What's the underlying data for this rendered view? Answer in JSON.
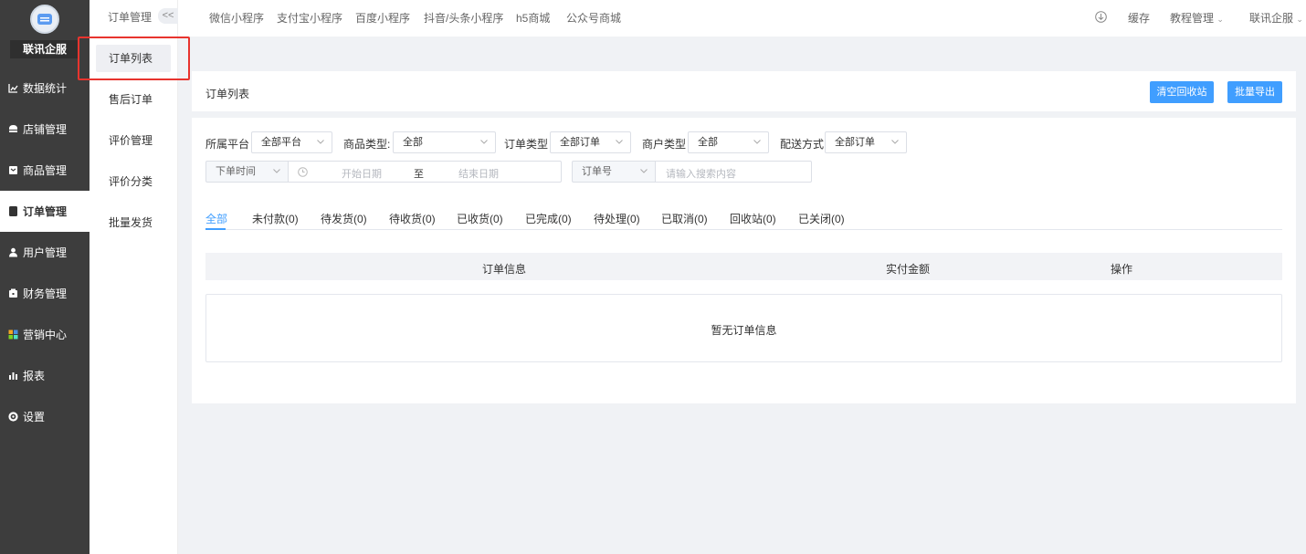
{
  "brand": {
    "name": "联讯企服"
  },
  "sidebar": {
    "items": [
      {
        "label": "数据统计",
        "icon": "line-chart-icon"
      },
      {
        "label": "店铺管理",
        "icon": "shop-icon"
      },
      {
        "label": "商品管理",
        "icon": "goods-box-icon"
      },
      {
        "label": "订单管理",
        "icon": "order-doc-icon",
        "active": true
      },
      {
        "label": "用户管理",
        "icon": "user-icon"
      },
      {
        "label": "财务管理",
        "icon": "wallet-icon"
      },
      {
        "label": "营销中心",
        "icon": "marketing-icon"
      },
      {
        "label": "报表",
        "icon": "bar-chart-icon"
      },
      {
        "label": "设置",
        "icon": "gear-icon"
      }
    ]
  },
  "submenu": {
    "title": "订单管理",
    "collapse": "<<",
    "items": [
      "订单列表",
      "售后订单",
      "评价管理",
      "评价分类",
      "批量发货"
    ]
  },
  "topbar": {
    "links": [
      "微信小程序",
      "支付宝小程序",
      "百度小程序",
      "抖音/头条小程序",
      "h5商城",
      "公众号商城"
    ],
    "cache": "缓存",
    "tutorial": "教程管理",
    "account": "联讯企服"
  },
  "page": {
    "title": "订单列表",
    "btn_clear": "清空回收站",
    "btn_export": "批量导出"
  },
  "filters": {
    "platform_label": "所属平台",
    "platform_value": "全部平台",
    "goods_type_label": "商品类型:",
    "goods_type_value": "全部",
    "order_type_label": "订单类型",
    "order_type_value": "全部订单",
    "merchant_type_label": "商户类型",
    "merchant_type_value": "全部",
    "delivery_label": "配送方式",
    "delivery_value": "全部订单",
    "time_select": "下单时间",
    "start_placeholder": "开始日期",
    "to": "至",
    "end_placeholder": "结束日期",
    "search_field": "订单号",
    "search_placeholder": "请输入搜索内容"
  },
  "tabs": [
    "全部",
    "未付款(0)",
    "待发货(0)",
    "待收货(0)",
    "已收货(0)",
    "已完成(0)",
    "待处理(0)",
    "已取消(0)",
    "回收站(0)",
    "已关闭(0)"
  ],
  "table": {
    "headers": [
      "订单信息",
      "实付金额",
      "操作"
    ],
    "empty": "暂无订单信息"
  },
  "colors": {
    "accent": "#409eff",
    "sidebar": "#3d3d3d",
    "highlight": "#e8342e"
  }
}
